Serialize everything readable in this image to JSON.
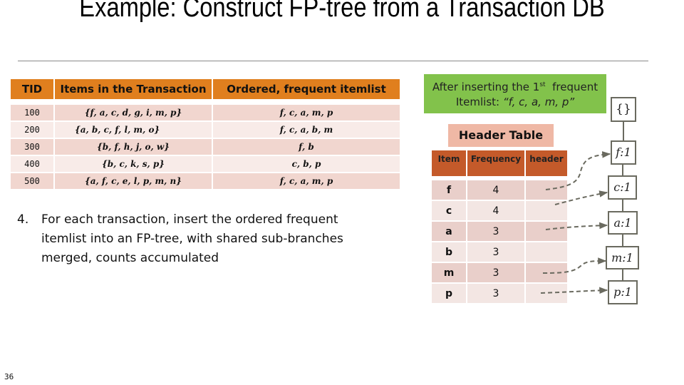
{
  "slide": {
    "title": "Example: Construct FP-tree from a Transaction DB",
    "page_number": "36"
  },
  "transactions": {
    "headers": [
      "TID",
      "Items in the Transaction",
      "Ordered, frequent itemlist"
    ],
    "rows": [
      {
        "tid": "100",
        "items": "{f, a, c, d, g, i, m, p}",
        "ordered": "f, c, a, m, p"
      },
      {
        "tid": "200",
        "items": "{a, b, c, f, l, m, o}",
        "ordered": "f, c, a, b, m"
      },
      {
        "tid": "300",
        "items": "{b, f, h, j, o, w}",
        "ordered": "f, b"
      },
      {
        "tid": "400",
        "items": "{b, c, k, s, p}",
        "ordered": "c, b, p"
      },
      {
        "tid": "500",
        "items": "{a, f, c, e, l, p, m, n}",
        "ordered": "f, c, a, m, p"
      }
    ],
    "colors": {
      "header": "#e07f1e",
      "row_odd": "#f1d6cf",
      "row_even": "#f8ebe8"
    }
  },
  "step": {
    "number": "4.",
    "text": "For each transaction, insert the ordered frequent itemlist into an FP-tree, with shared sub-branches merged, counts accumulated"
  },
  "callout": {
    "line1_prefix": "After inserting the 1",
    "line1_sup": "st",
    "line1_suffix": "frequent",
    "line2_prefix": "Itemlist: ",
    "line2_quote": "“f, c, a, m, p”",
    "color": "#82c24b"
  },
  "header_table": {
    "title": "Header Table",
    "columns": [
      "Item",
      "Frequency",
      "header"
    ],
    "rows": [
      {
        "item": "f",
        "frequency": "4"
      },
      {
        "item": "c",
        "frequency": "4"
      },
      {
        "item": "a",
        "frequency": "3"
      },
      {
        "item": "b",
        "frequency": "3"
      },
      {
        "item": "m",
        "frequency": "3"
      },
      {
        "item": "p",
        "frequency": "3"
      }
    ],
    "colors": {
      "title_bg": "#efb8a5",
      "header_bg": "#c45a2a"
    }
  },
  "fp_tree": {
    "root": "{}",
    "nodes": [
      {
        "label": "f:1"
      },
      {
        "label": "c:1"
      },
      {
        "label": "a:1"
      },
      {
        "label": "m:1"
      },
      {
        "label": "p:1"
      }
    ],
    "edge_color": "#6a6a5f"
  }
}
